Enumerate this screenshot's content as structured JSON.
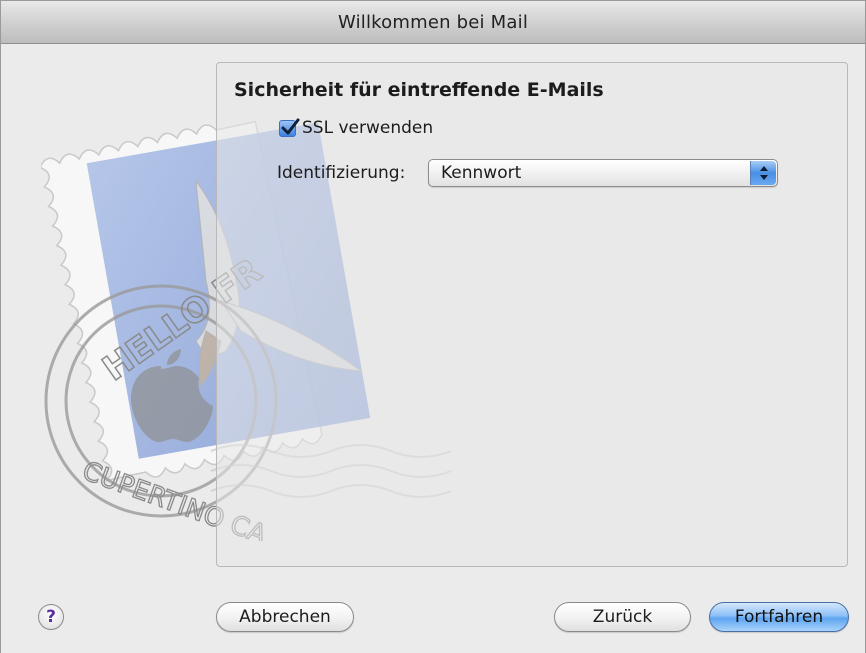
{
  "window": {
    "title": "Willkommen bei Mail"
  },
  "section": {
    "title": "Sicherheit für eintreffende E-Mails"
  },
  "ssl": {
    "label": "SSL verwenden",
    "checked": true
  },
  "auth": {
    "label": "Identifizierung:",
    "selected": "Kennwort"
  },
  "stamp": {
    "top_text": "HELLO FR",
    "bottom_text": "CUPERTINO CA"
  },
  "buttons": {
    "help": "?",
    "cancel": "Abbrechen",
    "back": "Zurück",
    "continue": "Fortfahren"
  },
  "colors": {
    "accent": "#4a8fe4",
    "help_glyph": "#5a2e9e",
    "stamp_blue": "#8ea7da"
  }
}
